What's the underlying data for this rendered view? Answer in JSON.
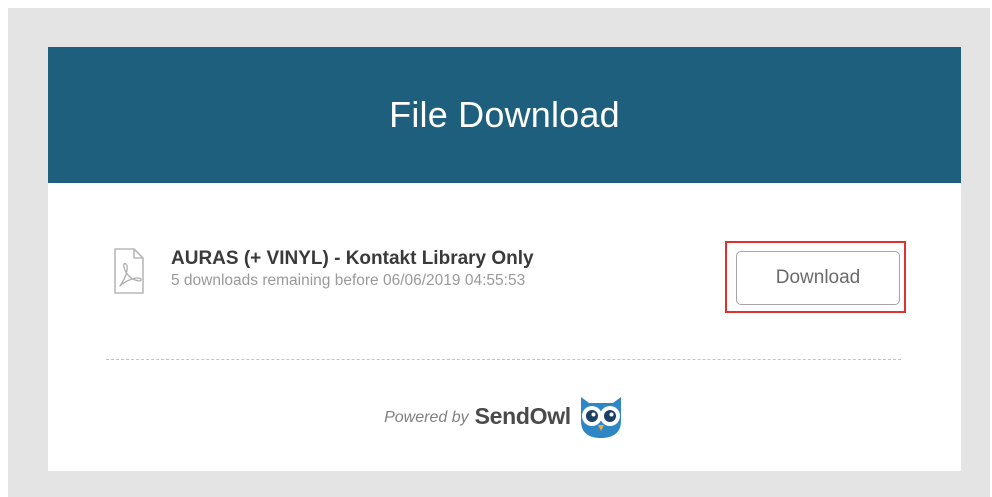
{
  "header": {
    "title": "File Download"
  },
  "file": {
    "icon": "pdf-file-icon",
    "name": "AURAS (+ VINYL) - Kontakt Library Only",
    "meta": "5 downloads remaining before 06/06/2019 04:55:53"
  },
  "actions": {
    "download_label": "Download"
  },
  "footer": {
    "powered_by": "Powered by",
    "brand": "SendOwl",
    "logo_icon": "owl-icon"
  },
  "colors": {
    "header_bg": "#1e5f7e",
    "page_bg": "#e4e4e4",
    "highlight": "#e0312e"
  }
}
